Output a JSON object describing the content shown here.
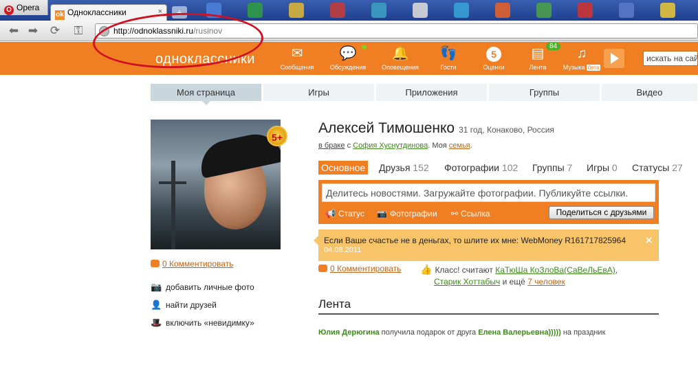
{
  "browser": {
    "menu_label": "Opera",
    "tab_title": "Одноклассники",
    "tab_close": "×",
    "new_tab": "+",
    "address_host": "http://odnoklassniki.ru",
    "address_path": "/rusinov",
    "annotation_color": "#d01020"
  },
  "site": {
    "logo": "одноклассники",
    "brand_color": "#f07f24",
    "search_placeholder": "искать на сайте",
    "topbar": [
      {
        "label": "Сообщения",
        "icon": "envelope-icon"
      },
      {
        "label": "Обсуждения",
        "icon": "chat-bubbles-icon"
      },
      {
        "label": "Оповещения",
        "icon": "bell-icon"
      },
      {
        "label": "Гости",
        "icon": "footprints-icon"
      },
      {
        "label": "Оценки",
        "icon": "rating-five-icon",
        "glyph": "5"
      },
      {
        "label": "Лента",
        "icon": "feed-icon",
        "badge": "84"
      },
      {
        "label": "Музыка",
        "icon": "music-note-icon",
        "beta": "бета"
      }
    ]
  },
  "menu": {
    "items": [
      "Моя страница",
      "Игры",
      "Приложения",
      "Группы",
      "Видео"
    ]
  },
  "left": {
    "avatar_badge": "5+",
    "comment_link": "0 Комментировать",
    "actions": [
      {
        "label": "добавить личные фото",
        "icon": "camera-icon"
      },
      {
        "label": "найти друзей",
        "icon": "person-icon"
      },
      {
        "label": "включить «невидимку»",
        "icon": "invisible-hat-icon"
      }
    ]
  },
  "profile": {
    "name": "Алексей Тимошенко",
    "info": "31 год, Конаково, Россия",
    "status_married": "в браке",
    "status_with": "с",
    "spouse": "София Хуснутдинова",
    "family_prefix": ". Моя",
    "family_link": "семья",
    "family_suffix": ".",
    "tabs": [
      {
        "label": "Основное",
        "count": ""
      },
      {
        "label": "Друзья",
        "count": "152"
      },
      {
        "label": "Фотографии",
        "count": "102"
      },
      {
        "label": "Группы",
        "count": "7"
      },
      {
        "label": "Игры",
        "count": "0"
      },
      {
        "label": "Статусы",
        "count": "27"
      }
    ]
  },
  "share": {
    "placeholder": "Делитесь новостями. Загружайте фотографии. Публикуйте ссылки.",
    "option_status": "Статус",
    "option_photos": "Фотографии",
    "option_link": "Ссылка",
    "button": "Поделиться с друзьями"
  },
  "notice": {
    "text": "Если Ваше счастье не в деньгах, то шлите их мне: WebMoney R161717825964",
    "date": "04.08.2011",
    "close": "✕"
  },
  "post": {
    "comment_link": "0 Комментировать",
    "likes_prefix": "Класс! считают",
    "liker1": "КаТюШа КоЗлоВа(СаВеЛьЕвА)",
    "separator": ",",
    "liker2": "Старик Хоттабыч",
    "more_prefix": "и ещё",
    "more_link": "7 человек"
  },
  "feed": {
    "title": "Лента",
    "item_user": "Юлия Дерюгина",
    "item_text": " получила подарок от друга ",
    "item_friend": "Елена Валерьевна)))))",
    "item_suffix": " на праздник"
  }
}
